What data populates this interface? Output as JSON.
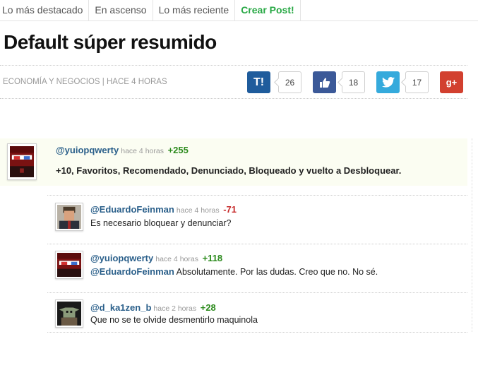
{
  "nav": {
    "tabs": [
      "Lo más destacado",
      "En ascenso",
      "Lo más reciente",
      "Crear Post!"
    ]
  },
  "post": {
    "title": "Default súper resumido",
    "meta": "ECONOMÍA Y NEGOCIOS | HACE 4 HORAS"
  },
  "share": {
    "taringa": {
      "icon": "taringa-icon",
      "label": "T!",
      "count": "26",
      "color": "#1f5c9c"
    },
    "facebook": {
      "icon": "thumbs-up-icon",
      "count": "18",
      "color": "#3b5998"
    },
    "twitter": {
      "icon": "twitter-bird-icon",
      "count": "17",
      "color": "#35aadc"
    },
    "google": {
      "icon": "google-plus-icon",
      "label": "g+",
      "color": "#d2402f"
    }
  },
  "comments": [
    {
      "user": "@yuiopqwerty",
      "time": "hace 4 horas",
      "score": "+255",
      "text": "+10, Favoritos, Recomendado, Denunciado, Bloqueado y vuelto a Desbloquear."
    },
    {
      "user": "@EduardoFeinman",
      "time": "hace 4 horas",
      "score": "-71",
      "text": "Es necesario bloquear y denunciar?"
    },
    {
      "user": "@yuiopqwerty",
      "time": "hace 4 horas",
      "score": "+118",
      "mention": "@EduardoFeinman",
      "text": " Absolutamente. Por las dudas. Creo que no. No sé."
    },
    {
      "user": "@d_ka1zen_b",
      "time": "hace 2 horas",
      "score": "+28",
      "text": "Que no se te olvide desmentirlo maquinola"
    }
  ]
}
